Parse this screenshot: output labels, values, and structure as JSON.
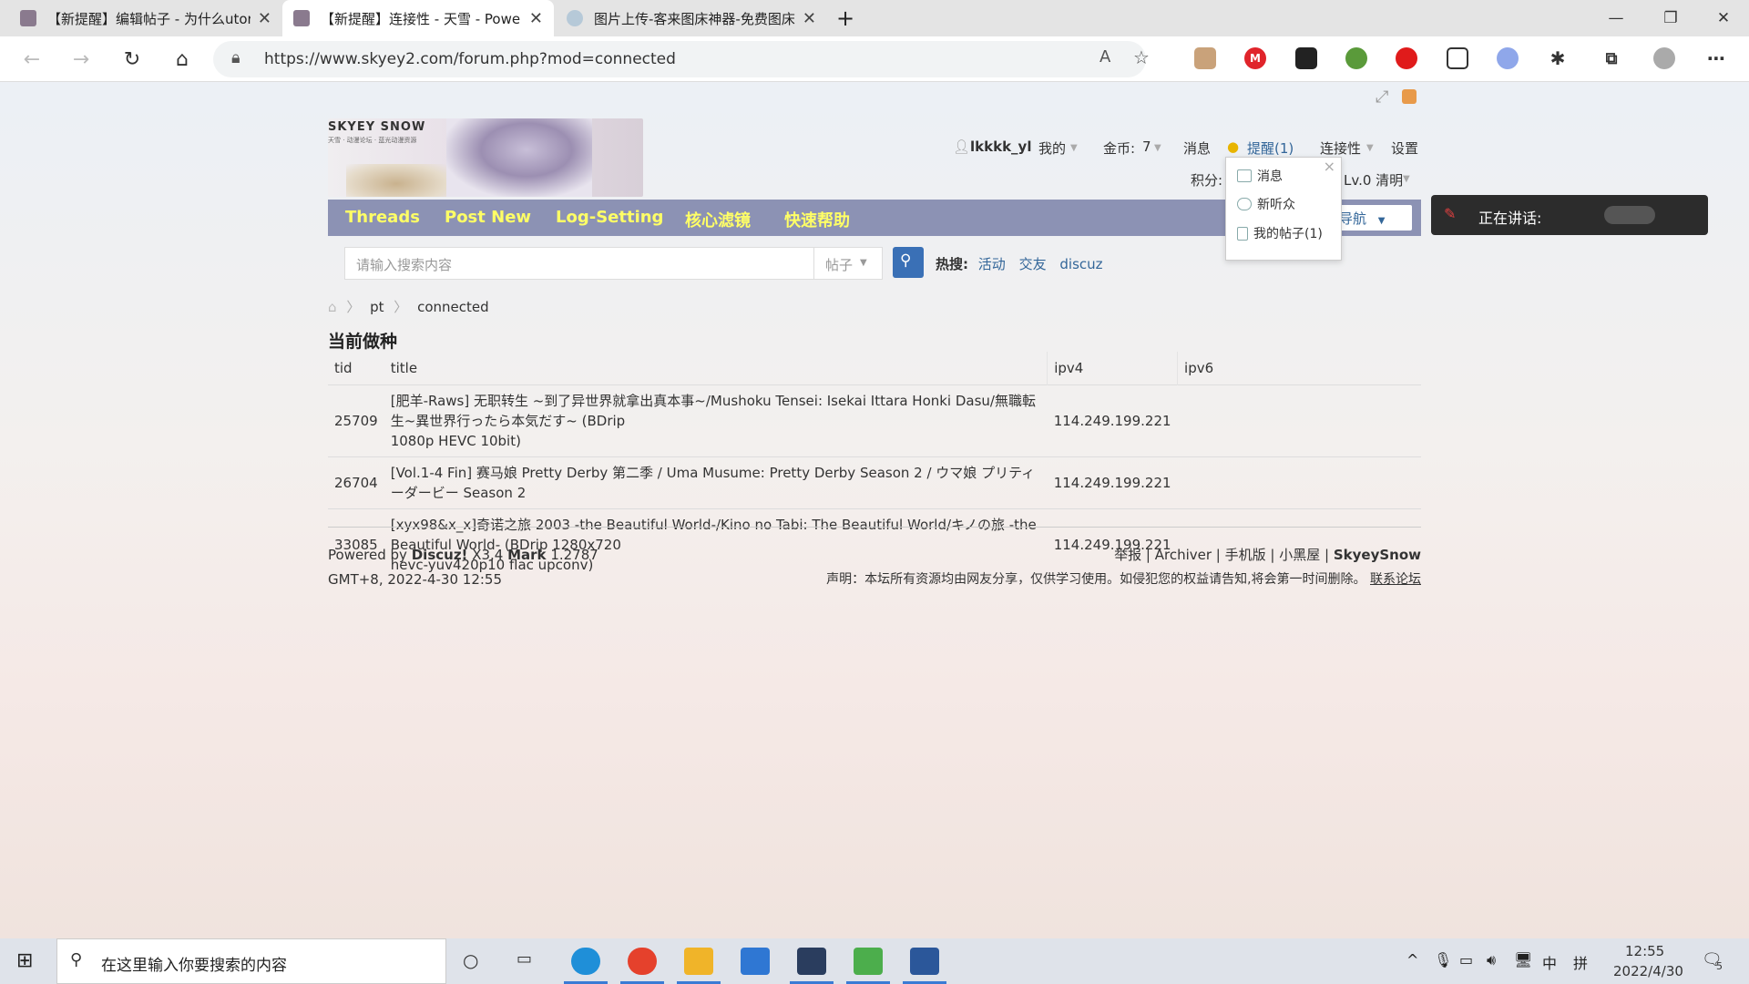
{
  "browser": {
    "tabs": [
      {
        "title": "【新提醒】编辑帖子 - 为什么utor"
      },
      {
        "title": "【新提醒】连接性 - 天雪 - Powe"
      },
      {
        "title": "图片上传-客来图床神器-免费图床"
      }
    ],
    "new_tab_label": "+",
    "url": "https://www.skyey2.com/forum.php?mod=connected"
  },
  "header": {
    "logo_text": "SKYEY SNOW",
    "logo_subtitle": "天雪 · 动漫论坛 · 蓝光动漫资源",
    "username": "lkkkk_yl",
    "my_menu": "我的",
    "coins_label": "金币:",
    "coins_value": "7",
    "messages": "消息",
    "reminder": "提醒(1)",
    "connectivity": "连接性",
    "settings": "设置",
    "points_label": "积分:",
    "level": "Lv.0 清明"
  },
  "nav": {
    "items": [
      "Threads",
      "Post New",
      "Log-Setting",
      "核心滤镜",
      "快速帮助"
    ],
    "nav_dropdown": "导航"
  },
  "search": {
    "placeholder": "请输入搜索内容",
    "type": "帖子",
    "hot_label": "热搜:",
    "hot_items": [
      "活动",
      "交友",
      "discuz"
    ]
  },
  "breadcrumb": {
    "items": [
      "pt",
      "connected"
    ]
  },
  "page_title": "当前做种",
  "table": {
    "headers": [
      "tid",
      "title",
      "ipv4",
      "ipv6"
    ],
    "rows": [
      {
        "tid": "25709",
        "title_line1": "[肥羊-Raws] 无职转生 ~到了异世界就拿出真本事~/Mushoku Tensei: Isekai Ittara Honki Dasu/無職転生~異世界行ったら本気だす~ (BDrip",
        "title_line2": "1080p HEVC 10bit)",
        "ipv4": "114.249.199.221",
        "ipv6": ""
      },
      {
        "tid": "26704",
        "title_line1": "[Vol.1-4 Fin] 赛马娘 Pretty Derby 第二季 / Uma Musume: Pretty Derby Season 2 / ウマ娘 プリティーダービー Season 2",
        "title_line2": "",
        "ipv4": "114.249.199.221",
        "ipv6": ""
      },
      {
        "tid": "33085",
        "title_line1": "[xyx98&x_x]奇诺之旅 2003 -the Beautiful World-/Kino no Tabi: The Beautiful World/キノの旅 -the Beautiful World- (BDrip 1280x720",
        "title_line2": "hevc-yuv420p10 flac upconv)",
        "ipv4": "114.249.199.221",
        "ipv6": ""
      }
    ]
  },
  "footer": {
    "powered_by": "Powered by",
    "discuz": "Discuz!",
    "version": "X3.4",
    "mark": "Mark",
    "mark_version": "1.2787",
    "time": "GMT+8, 2022-4-30 12:55",
    "links": [
      "举报",
      "Archiver",
      "手机版",
      "小黑屋",
      "SkyeySnow"
    ],
    "disclaimer": "声明：本坛所有资源均由网友分享，仅供学习使用。如侵犯您的权益请告知,将会第一时间删除。",
    "contact": "联系论坛"
  },
  "notify_popup": {
    "close": "×",
    "items": [
      "消息",
      "新听众",
      "我的帖子(1)"
    ]
  },
  "call_widget": {
    "label": "正在讲话:"
  },
  "taskbar": {
    "search_placeholder": "在这里输入你要搜索的内容",
    "time": "12:55",
    "date": "2022/4/30",
    "ime_lang": "中",
    "ime_mode": "拼",
    "notifications": "5"
  },
  "colors": {
    "nav_bg": "#8c92b4",
    "nav_text": "#ffff66",
    "link": "#336699",
    "search_button": "#3a70b6"
  }
}
